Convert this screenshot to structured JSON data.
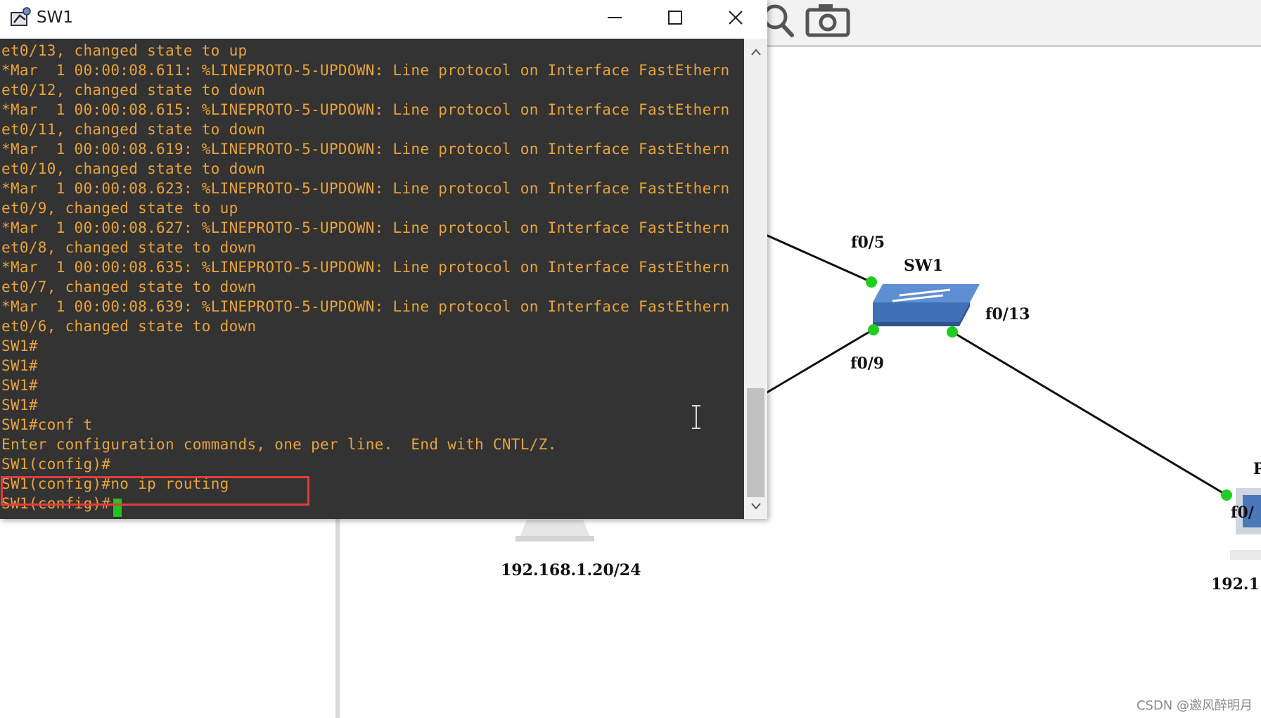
{
  "window": {
    "title": "SW1"
  },
  "terminal": {
    "lines": [
      "et0/13, changed state to up",
      "*Mar  1 00:00:08.611: %LINEPROTO-5-UPDOWN: Line protocol on Interface FastEthern",
      "et0/12, changed state to down",
      "*Mar  1 00:00:08.615: %LINEPROTO-5-UPDOWN: Line protocol on Interface FastEthern",
      "et0/11, changed state to down",
      "*Mar  1 00:00:08.619: %LINEPROTO-5-UPDOWN: Line protocol on Interface FastEthern",
      "et0/10, changed state to down",
      "*Mar  1 00:00:08.623: %LINEPROTO-5-UPDOWN: Line protocol on Interface FastEthern",
      "et0/9, changed state to up",
      "*Mar  1 00:00:08.627: %LINEPROTO-5-UPDOWN: Line protocol on Interface FastEthern",
      "et0/8, changed state to down",
      "*Mar  1 00:00:08.635: %LINEPROTO-5-UPDOWN: Line protocol on Interface FastEthern",
      "et0/7, changed state to down",
      "*Mar  1 00:00:08.639: %LINEPROTO-5-UPDOWN: Line protocol on Interface FastEthern",
      "et0/6, changed state to down",
      "SW1#",
      "SW1#",
      "SW1#",
      "SW1#",
      "SW1#conf t",
      "Enter configuration commands, one per line.  End with CNTL/Z.",
      "SW1(config)#",
      "SW1(config)#no ip routing",
      "SW1(config)#"
    ],
    "text_color": "#e8a33c",
    "background_color": "#333333",
    "cursor_color": "#23c21f",
    "highlight_color": "#e23b3b"
  },
  "topology": {
    "switch_label": "SW1",
    "port_labels": {
      "f0_5": "f0/5",
      "f0_9": "f0/9",
      "f0_13": "f0/13",
      "f0_right": "f0/"
    },
    "pc_left_ip": "192.168.1.20/24",
    "pc_right_ip": "192.1",
    "right_host_label": "P",
    "link_up_color": "#22cc22",
    "switch_color": "#3f6fb5"
  },
  "toolbar": {
    "icons": [
      "zoom-icon",
      "camera-icon"
    ]
  },
  "watermark": "CSDN @邀风醉明月"
}
